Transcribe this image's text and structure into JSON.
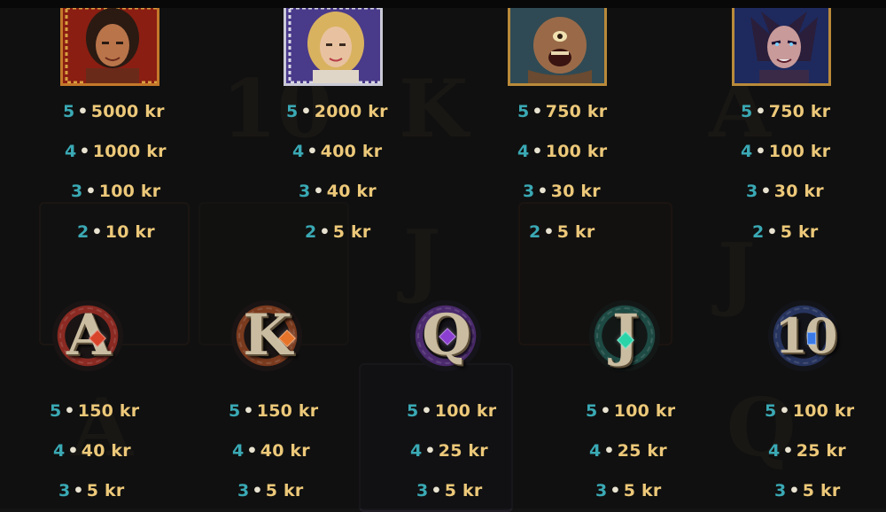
{
  "premium_symbols": [
    {
      "symbol": "warrior-portrait-icon",
      "frame_color": "#c4782a",
      "pays": [
        {
          "count": "5",
          "amount": "5000 kr"
        },
        {
          "count": "4",
          "amount": "1000 kr"
        },
        {
          "count": "3",
          "amount": "100 kr"
        },
        {
          "count": "2",
          "amount": "10 kr"
        }
      ]
    },
    {
      "symbol": "goddess-portrait-icon",
      "frame_color": "#c9c9d6",
      "pays": [
        {
          "count": "5",
          "amount": "2000 kr"
        },
        {
          "count": "4",
          "amount": "400 kr"
        },
        {
          "count": "3",
          "amount": "40 kr"
        },
        {
          "count": "2",
          "amount": "5 kr"
        }
      ]
    },
    {
      "symbol": "cyclops-portrait-icon",
      "frame_color": "#b98a3a",
      "pays": [
        {
          "count": "5",
          "amount": "750 kr"
        },
        {
          "count": "4",
          "amount": "100 kr"
        },
        {
          "count": "3",
          "amount": "30 kr"
        },
        {
          "count": "2",
          "amount": "5 kr"
        }
      ]
    },
    {
      "symbol": "harpy-portrait-icon",
      "frame_color": "#b98a3a",
      "pays": [
        {
          "count": "5",
          "amount": "750 kr"
        },
        {
          "count": "4",
          "amount": "100 kr"
        },
        {
          "count": "3",
          "amount": "30 kr"
        },
        {
          "count": "2",
          "amount": "5 kr"
        }
      ]
    }
  ],
  "royal_symbols": [
    {
      "symbol": "letter-a-icon",
      "glyph": "A",
      "gem_color": "#d8442a",
      "ring_color": "#8a2a22",
      "pays": [
        {
          "count": "5",
          "amount": "150 kr"
        },
        {
          "count": "4",
          "amount": "40 kr"
        },
        {
          "count": "3",
          "amount": "5 kr"
        }
      ]
    },
    {
      "symbol": "letter-k-icon",
      "glyph": "K",
      "gem_color": "#e5742a",
      "ring_color": "#7a3a1e",
      "pays": [
        {
          "count": "5",
          "amount": "150 kr"
        },
        {
          "count": "4",
          "amount": "40 kr"
        },
        {
          "count": "3",
          "amount": "5 kr"
        }
      ]
    },
    {
      "symbol": "letter-q-icon",
      "glyph": "Q",
      "gem_color": "#8b3fd0",
      "ring_color": "#4b2a6e",
      "pays": [
        {
          "count": "5",
          "amount": "100 kr"
        },
        {
          "count": "4",
          "amount": "25 kr"
        },
        {
          "count": "3",
          "amount": "5 kr"
        }
      ]
    },
    {
      "symbol": "letter-j-icon",
      "glyph": "J",
      "gem_color": "#2bd3a8",
      "ring_color": "#1e4a44",
      "pays": [
        {
          "count": "5",
          "amount": "100 kr"
        },
        {
          "count": "4",
          "amount": "25 kr"
        },
        {
          "count": "3",
          "amount": "5 kr"
        }
      ]
    },
    {
      "symbol": "ten-icon",
      "glyph": "10",
      "gem_color": "#3a7ae8",
      "ring_color": "#27345e",
      "pays": [
        {
          "count": "5",
          "amount": "100 kr"
        },
        {
          "count": "4",
          "amount": "25 kr"
        },
        {
          "count": "3",
          "amount": "5 kr"
        }
      ]
    }
  ]
}
